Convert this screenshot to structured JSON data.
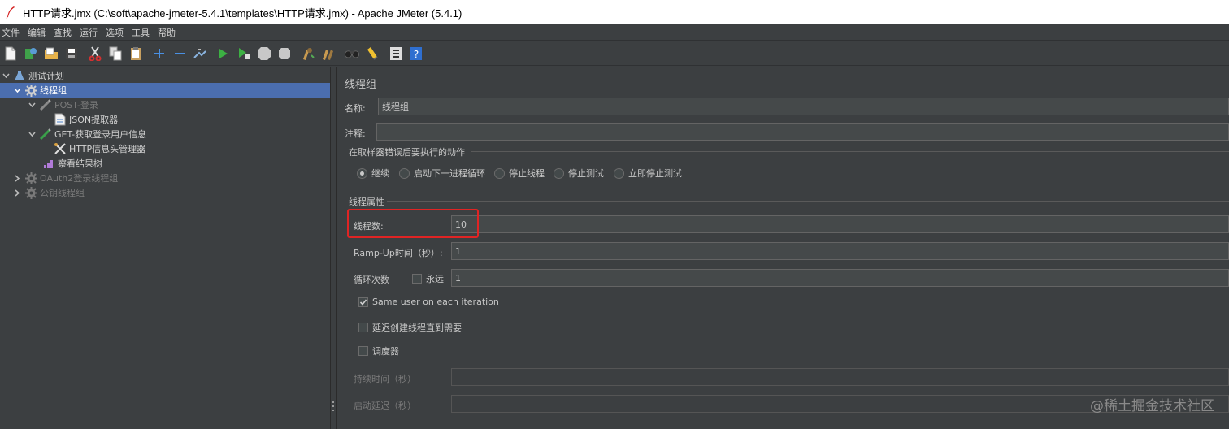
{
  "window": {
    "title": "HTTP请求.jmx (C:\\soft\\apache-jmeter-5.4.1\\templates\\HTTP请求.jmx) - Apache JMeter (5.4.1)"
  },
  "menu": [
    "文件",
    "编辑",
    "查找",
    "运行",
    "选项",
    "工具",
    "帮助"
  ],
  "toolbar": [
    "new-icon",
    "templates-icon",
    "open-icon",
    "save-icon",
    "cut-icon",
    "copy-icon",
    "paste-icon",
    "expand-icon",
    "collapse-icon",
    "toggle-icon",
    "start-icon",
    "start-no-pause-icon",
    "stop-icon",
    "shutdown-icon",
    "clear-icon",
    "clear-all-icon",
    "search-icon",
    "reset-search-icon",
    "function-helper-icon",
    "help-icon"
  ],
  "tree": {
    "items": [
      {
        "label": "测试计划",
        "icon": "test-plan-icon",
        "level": 0,
        "expanded": true
      },
      {
        "label": "线程组",
        "icon": "gear-icon",
        "level": 1,
        "expanded": true,
        "selected": true
      },
      {
        "label": "POST-登录",
        "icon": "sampler-icon",
        "level": 2,
        "expanded": true,
        "disabled": true
      },
      {
        "label": "JSON提取器",
        "icon": "extractor-icon",
        "level": 3
      },
      {
        "label": "GET-获取登录用户信息",
        "icon": "sampler-icon",
        "level": 2,
        "expanded": true
      },
      {
        "label": "HTTP信息头管理器",
        "icon": "header-manager-icon",
        "level": 3
      },
      {
        "label": "察看结果树",
        "icon": "listener-icon",
        "level": 2
      },
      {
        "label": "OAuth2登录线程组",
        "icon": "gear-icon",
        "level": 1,
        "expanded": false,
        "disabled": true
      },
      {
        "label": "公钥线程组",
        "icon": "gear-icon",
        "level": 1,
        "expanded": false,
        "disabled": true
      }
    ]
  },
  "panel": {
    "title": "线程组",
    "name_label": "名称:",
    "name_value": "线程组",
    "comment_label": "注释:",
    "comment_value": "",
    "error_action_title": "在取样器错误后要执行的动作",
    "error_actions": [
      {
        "label": "继续",
        "checked": true
      },
      {
        "label": "启动下一进程循环",
        "checked": false
      },
      {
        "label": "停止线程",
        "checked": false
      },
      {
        "label": "停止测试",
        "checked": false
      },
      {
        "label": "立即停止测试",
        "checked": false
      }
    ],
    "thread_props_title": "线程属性",
    "threads_label": "线程数:",
    "threads_value": "10",
    "rampup_label": "Ramp-Up时间（秒）:",
    "rampup_value": "1",
    "loop_label": "循环次数",
    "forever_label": "永远",
    "forever_checked": false,
    "loop_value": "1",
    "same_user_label": "Same user on each iteration",
    "same_user_checked": true,
    "delay_label": "延迟创建线程直到需要",
    "delay_checked": false,
    "scheduler_label": "调度器",
    "scheduler_checked": false,
    "duration_label": "持续时间（秒）",
    "duration_value": "",
    "startup_delay_label": "启动延迟（秒）",
    "startup_delay_value": ""
  },
  "watermark": "@稀土掘金技术社区",
  "colors": {
    "background": "#3c3f41",
    "selection": "#4b6eaf",
    "highlight": "#e02424"
  }
}
